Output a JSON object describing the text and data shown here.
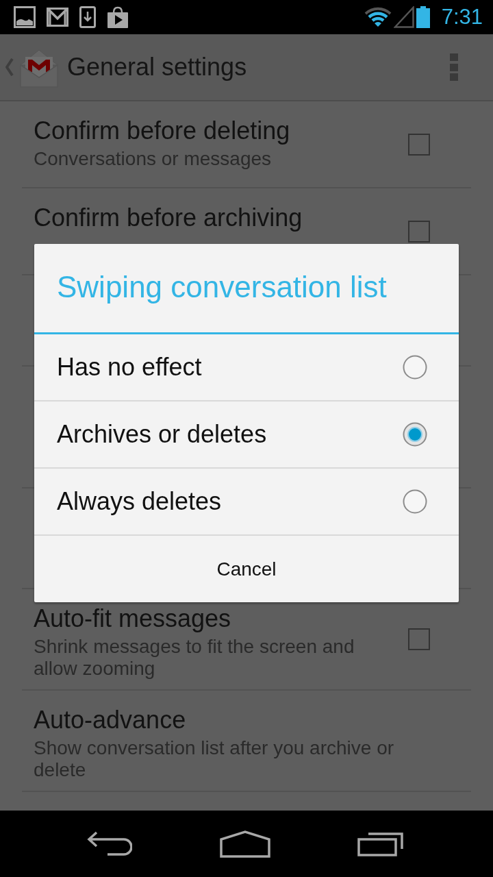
{
  "status_bar": {
    "time": "7:31"
  },
  "action_bar": {
    "title": "General settings"
  },
  "settings": [
    {
      "kind": "checkbox",
      "title": "Confirm before deleting",
      "summary": "Conversations or messages",
      "checked": false
    },
    {
      "kind": "checkbox",
      "title": "Confirm before archiving",
      "checked": false
    },
    {
      "kind": "checkbox",
      "title": "Auto-fit messages",
      "summary": "Shrink messages to fit the screen and allow zooming",
      "checked": false
    },
    {
      "kind": "list",
      "title": "Auto-advance",
      "summary": "Show conversation list after you archive or delete"
    }
  ],
  "dialog": {
    "title": "Swiping conversation list",
    "options": [
      {
        "label": "Has no effect",
        "selected": false
      },
      {
        "label": "Archives or deletes",
        "selected": true
      },
      {
        "label": "Always deletes",
        "selected": false
      }
    ],
    "cancel": "Cancel"
  }
}
